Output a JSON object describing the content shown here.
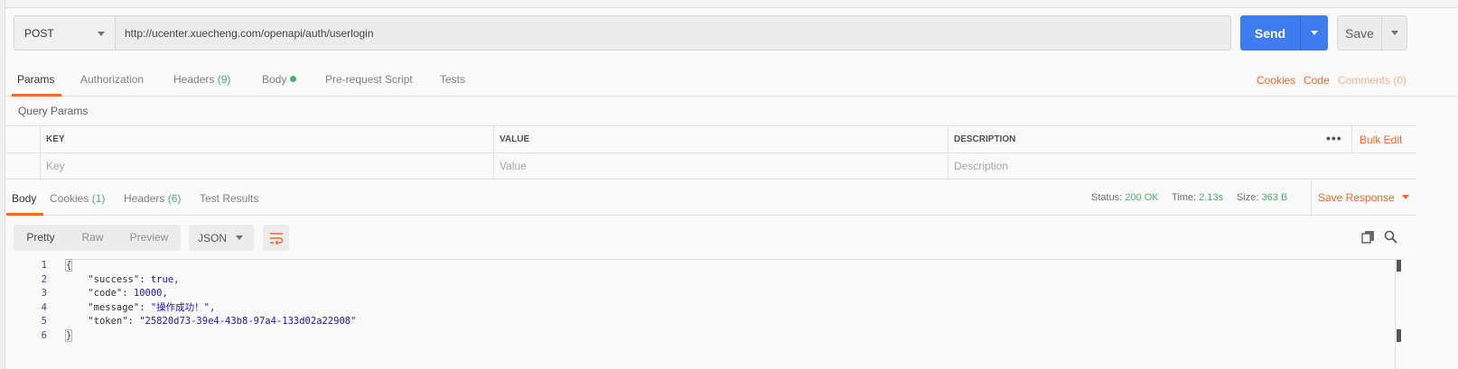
{
  "request": {
    "method": "POST",
    "url": "http://ucenter.xuecheng.com/openapi/auth/userlogin",
    "send_label": "Send",
    "save_label": "Save"
  },
  "request_tabs": {
    "params": "Params",
    "authorization": "Authorization",
    "headers": "Headers",
    "headers_count": "(9)",
    "body": "Body",
    "prerequest": "Pre-request Script",
    "tests": "Tests",
    "cookies": "Cookies",
    "code": "Code",
    "comments": "Comments (0)"
  },
  "query_params": {
    "title": "Query Params",
    "columns": [
      "KEY",
      "VALUE",
      "DESCRIPTION"
    ],
    "placeholders": [
      "Key",
      "Value",
      "Description"
    ],
    "more": "•••",
    "bulk_edit": "Bulk Edit"
  },
  "response_tabs": {
    "body": "Body",
    "cookies": "Cookies",
    "cookies_count": "(1)",
    "headers": "Headers",
    "headers_count": "(6)",
    "test_results": "Test Results"
  },
  "response_meta": {
    "status_label": "Status:",
    "status_value": "200 OK",
    "time_label": "Time:",
    "time_value": "2.13s",
    "size_label": "Size:",
    "size_value": "363 B",
    "save_response": "Save Response"
  },
  "view": {
    "pretty": "Pretty",
    "raw": "Raw",
    "preview": "Preview",
    "format": "JSON"
  },
  "code": {
    "line_numbers": [
      "1",
      "2",
      "3",
      "4",
      "5",
      "6"
    ],
    "open_brace": "{",
    "close_brace": "}",
    "success_key": "\"success\"",
    "success_value": "true",
    "code_key": "\"code\"",
    "code_value": "10000",
    "message_key": "\"message\"",
    "message_value": "\"操作成功！\"",
    "token_key": "\"token\"",
    "token_value": "\"25820d73-39e4-43b8-97a4-133d02a22908\""
  },
  "colors": {
    "accent": "#f06b2c",
    "send": "#3f7cf0",
    "success": "#4caf6a"
  },
  "icons": [
    "chevron-down-icon",
    "wrap-lines-icon",
    "copy-icon",
    "search-icon"
  ]
}
